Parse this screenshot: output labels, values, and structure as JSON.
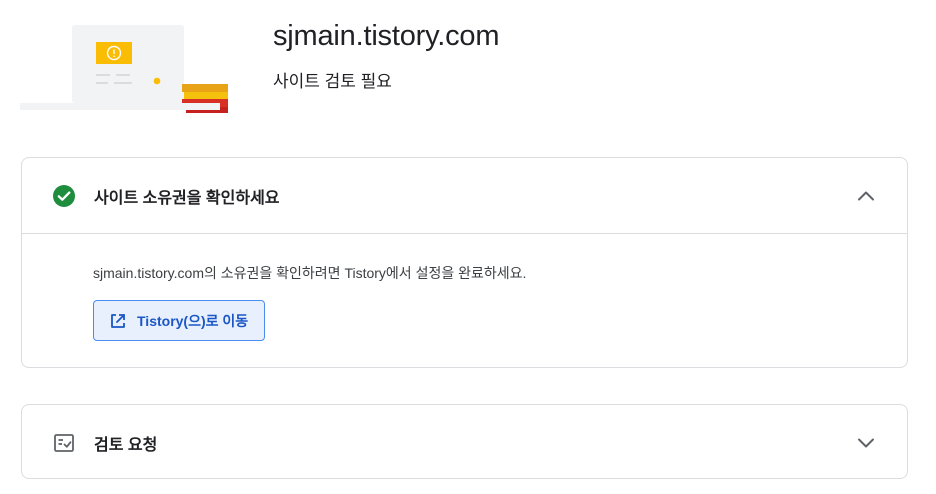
{
  "header": {
    "site_title": "sjmain.tistory.com",
    "site_status": "사이트 검토 필요",
    "illustration_icon": "laptop-warning-illustration"
  },
  "ownership_card": {
    "title": "사이트 소유권을 확인하세요",
    "status_icon": "check-circle-icon",
    "expanded": true,
    "description": "sjmain.tistory.com의 소유권을 확인하려면 Tistory에서 설정을 완료하세요.",
    "button_label": "Tistory(으)로 이동",
    "button_icon": "open-in-new-icon"
  },
  "review_card": {
    "title": "검토 요청",
    "icon": "review-checklist-icon",
    "expanded": false
  },
  "colors": {
    "success_green": "#1e8e3e",
    "accent_blue": "#1a56c5",
    "button_bg": "#e8f0fe",
    "warning_yellow": "#fbbc04"
  }
}
